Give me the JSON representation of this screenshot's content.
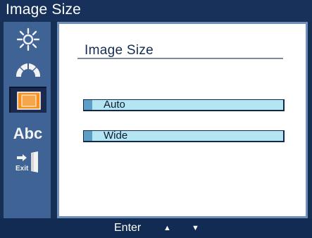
{
  "window": {
    "title": "Image Size"
  },
  "sidebar": {
    "items": [
      {
        "icon": "brightness-icon",
        "selected": false
      },
      {
        "icon": "color-icon",
        "selected": false
      },
      {
        "icon": "image-size-icon",
        "selected": true
      },
      {
        "icon": "language-icon",
        "label": "Abc",
        "selected": false
      },
      {
        "icon": "exit-icon",
        "label": "Exit",
        "selected": false
      }
    ]
  },
  "main": {
    "heading": "Image Size",
    "options": [
      {
        "label": "Auto"
      },
      {
        "label": "Wide"
      }
    ]
  },
  "bottombar": {
    "enter_label": "Enter",
    "up_arrow": "▲",
    "down_arrow": "▼"
  },
  "colors": {
    "frame": "#162f55",
    "sidebar": "#3f6394",
    "selected_icon": "#f7901e",
    "option_fill": "#b3e6f2",
    "option_marker": "#5d9ec8"
  }
}
